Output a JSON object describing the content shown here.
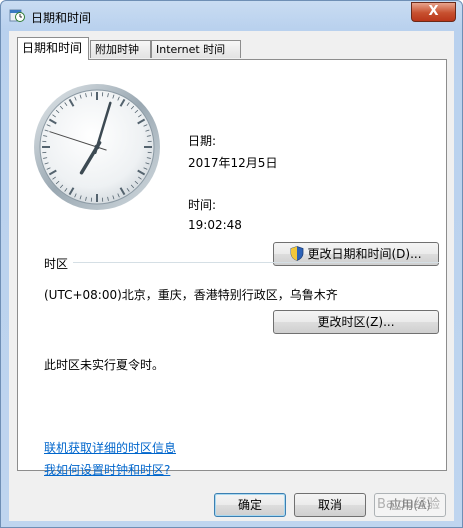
{
  "window": {
    "title": "日期和时间",
    "close": "X"
  },
  "tabs": [
    {
      "label": "日期和时间",
      "active": true
    },
    {
      "label": "附加时钟",
      "active": false
    },
    {
      "label": "Internet 时间",
      "active": false
    }
  ],
  "datetime": {
    "date_label": "日期:",
    "date_value": "2017年12月5日",
    "time_label": "时间:",
    "time_value": "19:02:48",
    "change_button": "更改日期和时间(D)..."
  },
  "timezone": {
    "section_label": "时区",
    "value": "(UTC+08:00)北京，重庆，香港特别行政区，乌鲁木齐",
    "change_button": "更改时区(Z)...",
    "dst_note": "此时区未实行夏令时。"
  },
  "links": {
    "online_info": "联机获取详细的时区信息",
    "how_to": "我如何设置时钟和时区?"
  },
  "footer": {
    "ok": "确定",
    "cancel": "取消",
    "apply": "应用(A)"
  },
  "watermark": "Baidu经验",
  "clock": {
    "hour": 19,
    "minute": 2,
    "second": 48
  }
}
